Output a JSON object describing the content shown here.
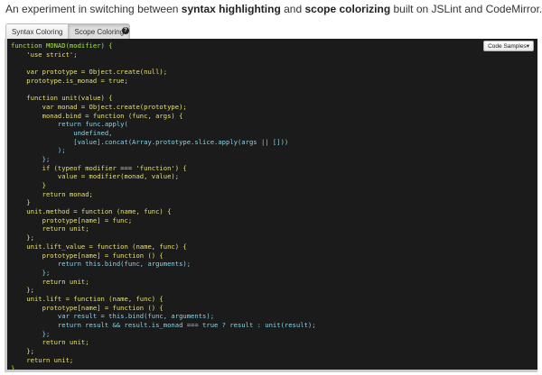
{
  "intro": {
    "part1": "An experiment in switching between ",
    "bold1": "syntax highlighting",
    "part2": " and ",
    "bold2": "scope colorizing",
    "part3": " built on JSLint and CodeMirror."
  },
  "toggle": {
    "syntax_label": "Syntax Coloring",
    "scope_label": "Scope Coloring",
    "active": "scope"
  },
  "help_icon": "?",
  "samples_button": "Code Samples▾",
  "colors": {
    "level0": "#a8e04a",
    "level1": "#e8e070",
    "level2": "#8ad4e8",
    "level3": "#8ad4e8"
  },
  "code_lines": [
    {
      "text": "function MONAD(modifier) {",
      "level": 0
    },
    {
      "text": "    'use strict';",
      "level": 1
    },
    {
      "text": "",
      "level": 1
    },
    {
      "text": "    var prototype = Object.create(null);",
      "level": 1
    },
    {
      "text": "    prototype.is_monad = true;",
      "level": 1
    },
    {
      "text": "",
      "level": 1
    },
    {
      "text": "    function unit(value) {",
      "level": 1
    },
    {
      "text": "        var monad = Object.create(prototype);",
      "level": 1
    },
    {
      "text": "        monad.bind = function (func, args) {",
      "level": 1
    },
    {
      "text": "            return func.apply(",
      "level": 2
    },
    {
      "text": "                undefined,",
      "level": 2
    },
    {
      "text": "                [value].concat(Array.prototype.slice.apply(args || []))",
      "level": 2
    },
    {
      "text": "            );",
      "level": 2
    },
    {
      "text": "        };",
      "level": 2
    },
    {
      "text": "        if (typeof modifier === 'function') {",
      "level": 1
    },
    {
      "text": "            value = modifier(monad, value);",
      "level": 1
    },
    {
      "text": "        }",
      "level": 1
    },
    {
      "text": "        return monad;",
      "level": 1
    },
    {
      "text": "    }",
      "level": 1
    },
    {
      "text": "    unit.method = function (name, func) {",
      "level": 1
    },
    {
      "text": "        prototype[name] = func;",
      "level": 1
    },
    {
      "text": "        return unit;",
      "level": 1
    },
    {
      "text": "    };",
      "level": 1
    },
    {
      "text": "    unit.lift_value = function (name, func) {",
      "level": 1
    },
    {
      "text": "        prototype[name] = function () {",
      "level": 1
    },
    {
      "text": "            return this.bind(func, arguments);",
      "level": 2
    },
    {
      "text": "        };",
      "level": 2
    },
    {
      "text": "        return unit;",
      "level": 1
    },
    {
      "text": "    };",
      "level": 1
    },
    {
      "text": "    unit.lift = function (name, func) {",
      "level": 1
    },
    {
      "text": "        prototype[name] = function () {",
      "level": 1
    },
    {
      "text": "            var result = this.bind(func, arguments);",
      "level": 2
    },
    {
      "text": "            return result && result.is_monad === true ? result : unit(result);",
      "level": 2
    },
    {
      "text": "        };",
      "level": 2
    },
    {
      "text": "        return unit;",
      "level": 1
    },
    {
      "text": "    };",
      "level": 1
    },
    {
      "text": "    return unit;",
      "level": 1
    },
    {
      "text": "}",
      "level": 0
    }
  ]
}
